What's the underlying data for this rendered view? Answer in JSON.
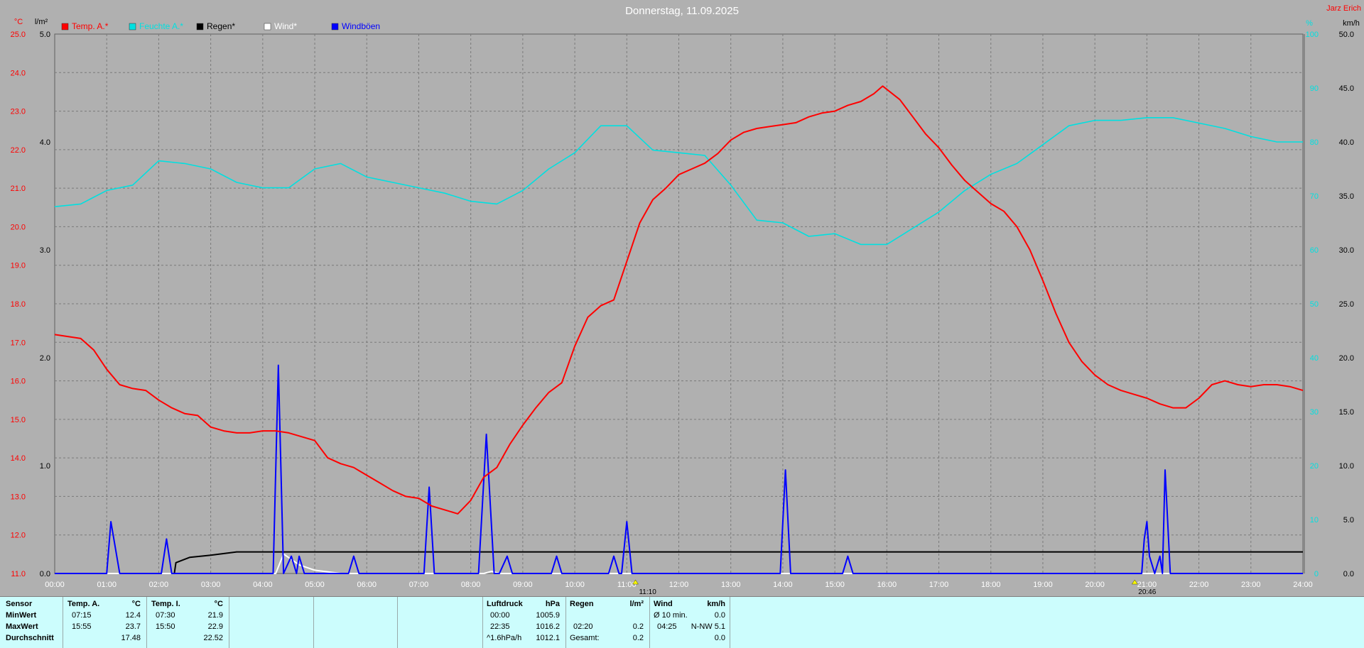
{
  "title": "Donnerstag, 11.09.2025",
  "corner_label": "Jarz Erich",
  "colors": {
    "background": "#b0b0b0",
    "temp_a": "#ff0000",
    "temp_i": "#00e0e0",
    "rain": "#000000",
    "wind": "#ffffff",
    "gust": "#0000ff",
    "table_bg": "#ccfdfd"
  },
  "chart_data": {
    "type": "line",
    "title": "Donnerstag, 11.09.2025",
    "x_range": [
      "00:00",
      "24:00"
    ],
    "x_ticks": [
      "00:00",
      "01:00",
      "02:00",
      "03:00",
      "04:00",
      "05:00",
      "06:00",
      "07:00",
      "08:00",
      "09:00",
      "10:00",
      "11:00",
      "12:00",
      "13:00",
      "14:00",
      "15:00",
      "16:00",
      "17:00",
      "18:00",
      "19:00",
      "20:00",
      "21:00",
      "22:00",
      "23:00",
      "24:00"
    ],
    "axes": {
      "temp": {
        "unit": "°C",
        "range": [
          11.0,
          25.0
        ],
        "ticks": [
          "11.0",
          "12.0",
          "13.0",
          "14.0",
          "15.0",
          "16.0",
          "17.0",
          "18.0",
          "19.0",
          "20.0",
          "21.0",
          "22.0",
          "23.0",
          "24.0",
          "25.0"
        ]
      },
      "rain": {
        "unit": "l/m²",
        "range": [
          0.0,
          5.0
        ],
        "ticks": [
          "0.0",
          "1.0",
          "2.0",
          "3.0",
          "4.0",
          "5.0"
        ]
      },
      "percent": {
        "unit": "%",
        "range": [
          0,
          100
        ],
        "ticks": [
          "0",
          "10",
          "20",
          "30",
          "40",
          "50",
          "60",
          "70",
          "80",
          "90",
          "100"
        ]
      },
      "wind": {
        "unit": "km/h",
        "range": [
          0.0,
          50.0
        ],
        "ticks": [
          "0.0",
          "5.0",
          "10.0",
          "15.0",
          "20.0",
          "25.0",
          "30.0",
          "35.0",
          "40.0",
          "45.0",
          "50.0"
        ]
      }
    },
    "grid": true,
    "legend_placement": "top-left",
    "series": [
      {
        "name": "Temp. A.*",
        "axis": "temp",
        "color": "#ff0000",
        "x": [
          0,
          0.25,
          0.5,
          0.75,
          1,
          1.25,
          1.5,
          1.75,
          2,
          2.25,
          2.5,
          2.75,
          3,
          3.25,
          3.5,
          3.75,
          4,
          4.25,
          4.5,
          4.75,
          5,
          5.25,
          5.5,
          5.75,
          6,
          6.25,
          6.5,
          6.75,
          7,
          7.25,
          7.5,
          7.75,
          8,
          8.25,
          8.5,
          8.75,
          9,
          9.25,
          9.5,
          9.75,
          10,
          10.25,
          10.5,
          10.75,
          11,
          11.25,
          11.5,
          11.75,
          12,
          12.25,
          12.5,
          12.75,
          13,
          13.25,
          13.5,
          13.75,
          14,
          14.25,
          14.5,
          14.75,
          15,
          15.25,
          15.5,
          15.75,
          15.92,
          16.25,
          16.5,
          16.75,
          17,
          17.25,
          17.5,
          17.75,
          18,
          18.25,
          18.5,
          18.75,
          19,
          19.25,
          19.5,
          19.75,
          20,
          20.25,
          20.5,
          20.75,
          21,
          21.25,
          21.5,
          21.75,
          22,
          22.25,
          22.5,
          22.75,
          23,
          23.25,
          23.5,
          23.75,
          24
        ],
        "y": [
          17.2,
          17.15,
          17.1,
          16.8,
          16.3,
          15.9,
          15.8,
          15.75,
          15.5,
          15.3,
          15.15,
          15.1,
          14.8,
          14.7,
          14.65,
          14.65,
          14.7,
          14.7,
          14.65,
          14.55,
          14.45,
          14.0,
          13.85,
          13.75,
          13.55,
          13.35,
          13.15,
          13.0,
          12.95,
          12.75,
          12.65,
          12.55,
          12.9,
          13.5,
          13.75,
          14.35,
          14.85,
          15.3,
          15.7,
          15.95,
          16.9,
          17.65,
          17.95,
          18.1,
          19.1,
          20.1,
          20.7,
          21.0,
          21.35,
          21.5,
          21.65,
          21.9,
          22.25,
          22.45,
          22.55,
          22.6,
          22.65,
          22.7,
          22.85,
          22.95,
          23.0,
          23.15,
          23.25,
          23.45,
          23.65,
          23.3,
          22.85,
          22.4,
          22.05,
          21.6,
          21.2,
          20.9,
          20.6,
          20.4,
          20.0,
          19.4,
          18.6,
          17.75,
          17.0,
          16.5,
          16.15,
          15.9,
          15.75,
          15.65,
          15.55,
          15.4,
          15.3,
          15.3,
          15.55,
          15.9,
          16.0,
          15.9,
          15.85,
          15.9,
          15.9,
          15.85,
          15.75
        ]
      },
      {
        "name": "Feuchte A.*",
        "axis": "percent",
        "color": "#00e0e0",
        "x": [
          0,
          0.5,
          1,
          1.5,
          2,
          2.5,
          3,
          3.5,
          4,
          4.5,
          5,
          5.5,
          6,
          6.5,
          7,
          7.5,
          8,
          8.5,
          9,
          9.5,
          10,
          10.5,
          11,
          11.5,
          12,
          12.5,
          13,
          13.5,
          14,
          14.5,
          15,
          15.5,
          16,
          16.5,
          17,
          17.5,
          18,
          18.5,
          19,
          19.5,
          20,
          20.5,
          21,
          21.5,
          22,
          22.5,
          23,
          23.5,
          24
        ],
        "y": [
          68,
          68.5,
          71,
          72,
          76.5,
          76,
          75,
          72.5,
          71.5,
          71.5,
          75,
          76,
          73.5,
          72.5,
          71.5,
          70.5,
          69,
          68.5,
          71,
          75,
          78,
          83,
          83,
          78.5,
          78,
          77.5,
          72,
          65.5,
          65,
          62.5,
          63,
          61,
          61,
          64,
          67,
          71,
          74,
          76,
          79.5,
          83,
          84,
          84,
          84.5,
          84.5,
          83.5,
          82.5,
          81,
          80,
          80
        ]
      },
      {
        "name": "Regen*",
        "axis": "rain",
        "color": "#000000",
        "x": [
          0,
          2.3,
          2.33,
          2.6,
          3,
          3.5,
          4,
          24
        ],
        "y": [
          0,
          0,
          0.1,
          0.15,
          0.17,
          0.2,
          0.2,
          0.2
        ]
      },
      {
        "name": "Wind*",
        "axis": "wind",
        "color": "#ffffff",
        "x": [
          0,
          4.25,
          4.4,
          4.7,
          5,
          5.5,
          6,
          8.25,
          8.4,
          8.55,
          9,
          21.6,
          24
        ],
        "y": [
          0,
          0,
          1.8,
          0.8,
          0.3,
          0,
          0,
          0,
          0.2,
          0,
          0,
          0,
          0
        ]
      },
      {
        "name": "Windböen",
        "axis": "wind",
        "color": "#0000ff",
        "x": [
          0,
          1.0,
          1.08,
          1.25,
          2.05,
          2.15,
          2.25,
          4.2,
          4.3,
          4.4,
          4.55,
          4.65,
          4.7,
          4.8,
          5.65,
          5.75,
          5.85,
          7.1,
          7.2,
          7.3,
          8.15,
          8.3,
          8.45,
          8.55,
          8.7,
          8.8,
          9.55,
          9.65,
          9.75,
          10.65,
          10.75,
          10.85,
          10.9,
          11.0,
          11.1,
          13.95,
          14.05,
          14.15,
          15.15,
          15.25,
          15.35,
          20.9,
          20.95,
          21.0,
          21.05,
          21.15,
          21.25,
          21.3,
          21.35,
          21.45,
          21.55,
          21.65,
          24
        ],
        "y": [
          0,
          0,
          4.8,
          0,
          0,
          3.2,
          0,
          0,
          19.3,
          0,
          1.6,
          0,
          1.6,
          0,
          0,
          1.6,
          0,
          0,
          8.0,
          0,
          0,
          12.9,
          0,
          0,
          1.6,
          0,
          0,
          1.6,
          0,
          0,
          1.6,
          0,
          0,
          4.8,
          0,
          0,
          9.6,
          0,
          0,
          1.6,
          0,
          0,
          3.2,
          4.8,
          1.6,
          0,
          1.6,
          0,
          9.6,
          0,
          0,
          0,
          0
        ]
      }
    ],
    "markers": [
      {
        "x": "11:10",
        "label": "11:10"
      },
      {
        "x": "20:46",
        "label": "20:46"
      }
    ]
  },
  "table": {
    "rows": [
      "Sensor",
      "MinWert",
      "MaxWert",
      "Durchschnitt"
    ],
    "temp_a": {
      "header": "Temp. A.",
      "unit": "°C",
      "min_time": "07:15",
      "min": "12.4",
      "max_time": "15:55",
      "max": "23.7",
      "avg": "17.48"
    },
    "temp_i": {
      "header": "Temp. I.",
      "unit": "°C",
      "min_time": "07:30",
      "min": "21.9",
      "max_time": "15:50",
      "max": "22.9",
      "avg": "22.52"
    },
    "pressure": {
      "header": "Luftdruck",
      "unit": "hPa",
      "min_time": "00:00",
      "min": "1005.9",
      "max_time": "22:35",
      "max": "1016.2",
      "trend_label": "^1.6hPa/h",
      "trend_value": "1012.1"
    },
    "rain": {
      "header": "Regen",
      "unit": "l/m²",
      "time": "02:20",
      "value": "0.2",
      "total_label": "Gesamt:",
      "total": "0.2"
    },
    "wind": {
      "header": "Wind",
      "unit": "km/h",
      "avg_label": "Ø 10 min.",
      "avg": "0.0",
      "max_time": "04:25",
      "max": "N-NW 5.1",
      "last": "0.0"
    }
  }
}
